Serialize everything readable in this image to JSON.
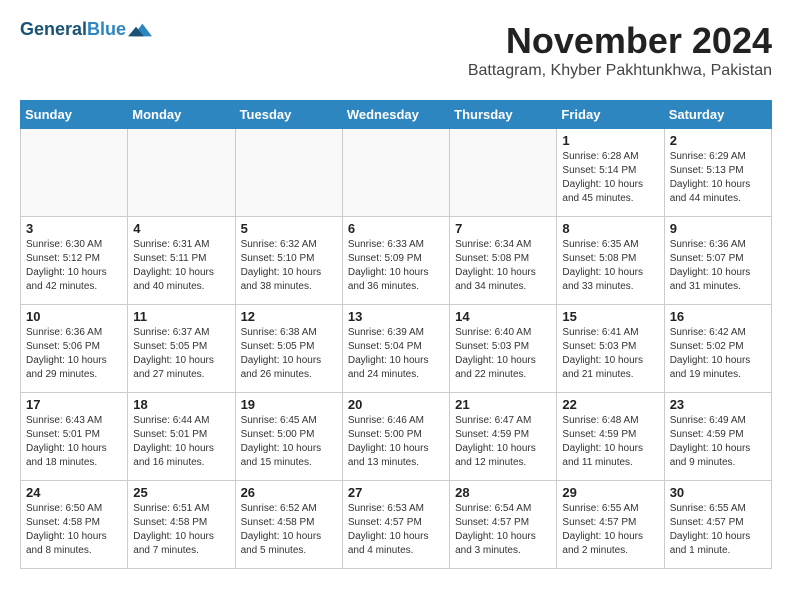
{
  "header": {
    "logo_line1": "General",
    "logo_line2": "Blue",
    "month_title": "November 2024",
    "location": "Battagram, Khyber Pakhtunkhwa, Pakistan"
  },
  "weekdays": [
    "Sunday",
    "Monday",
    "Tuesday",
    "Wednesday",
    "Thursday",
    "Friday",
    "Saturday"
  ],
  "weeks": [
    [
      {
        "day": "",
        "info": ""
      },
      {
        "day": "",
        "info": ""
      },
      {
        "day": "",
        "info": ""
      },
      {
        "day": "",
        "info": ""
      },
      {
        "day": "",
        "info": ""
      },
      {
        "day": "1",
        "info": "Sunrise: 6:28 AM\nSunset: 5:14 PM\nDaylight: 10 hours and 45 minutes."
      },
      {
        "day": "2",
        "info": "Sunrise: 6:29 AM\nSunset: 5:13 PM\nDaylight: 10 hours and 44 minutes."
      }
    ],
    [
      {
        "day": "3",
        "info": "Sunrise: 6:30 AM\nSunset: 5:12 PM\nDaylight: 10 hours and 42 minutes."
      },
      {
        "day": "4",
        "info": "Sunrise: 6:31 AM\nSunset: 5:11 PM\nDaylight: 10 hours and 40 minutes."
      },
      {
        "day": "5",
        "info": "Sunrise: 6:32 AM\nSunset: 5:10 PM\nDaylight: 10 hours and 38 minutes."
      },
      {
        "day": "6",
        "info": "Sunrise: 6:33 AM\nSunset: 5:09 PM\nDaylight: 10 hours and 36 minutes."
      },
      {
        "day": "7",
        "info": "Sunrise: 6:34 AM\nSunset: 5:08 PM\nDaylight: 10 hours and 34 minutes."
      },
      {
        "day": "8",
        "info": "Sunrise: 6:35 AM\nSunset: 5:08 PM\nDaylight: 10 hours and 33 minutes."
      },
      {
        "day": "9",
        "info": "Sunrise: 6:36 AM\nSunset: 5:07 PM\nDaylight: 10 hours and 31 minutes."
      }
    ],
    [
      {
        "day": "10",
        "info": "Sunrise: 6:36 AM\nSunset: 5:06 PM\nDaylight: 10 hours and 29 minutes."
      },
      {
        "day": "11",
        "info": "Sunrise: 6:37 AM\nSunset: 5:05 PM\nDaylight: 10 hours and 27 minutes."
      },
      {
        "day": "12",
        "info": "Sunrise: 6:38 AM\nSunset: 5:05 PM\nDaylight: 10 hours and 26 minutes."
      },
      {
        "day": "13",
        "info": "Sunrise: 6:39 AM\nSunset: 5:04 PM\nDaylight: 10 hours and 24 minutes."
      },
      {
        "day": "14",
        "info": "Sunrise: 6:40 AM\nSunset: 5:03 PM\nDaylight: 10 hours and 22 minutes."
      },
      {
        "day": "15",
        "info": "Sunrise: 6:41 AM\nSunset: 5:03 PM\nDaylight: 10 hours and 21 minutes."
      },
      {
        "day": "16",
        "info": "Sunrise: 6:42 AM\nSunset: 5:02 PM\nDaylight: 10 hours and 19 minutes."
      }
    ],
    [
      {
        "day": "17",
        "info": "Sunrise: 6:43 AM\nSunset: 5:01 PM\nDaylight: 10 hours and 18 minutes."
      },
      {
        "day": "18",
        "info": "Sunrise: 6:44 AM\nSunset: 5:01 PM\nDaylight: 10 hours and 16 minutes."
      },
      {
        "day": "19",
        "info": "Sunrise: 6:45 AM\nSunset: 5:00 PM\nDaylight: 10 hours and 15 minutes."
      },
      {
        "day": "20",
        "info": "Sunrise: 6:46 AM\nSunset: 5:00 PM\nDaylight: 10 hours and 13 minutes."
      },
      {
        "day": "21",
        "info": "Sunrise: 6:47 AM\nSunset: 4:59 PM\nDaylight: 10 hours and 12 minutes."
      },
      {
        "day": "22",
        "info": "Sunrise: 6:48 AM\nSunset: 4:59 PM\nDaylight: 10 hours and 11 minutes."
      },
      {
        "day": "23",
        "info": "Sunrise: 6:49 AM\nSunset: 4:59 PM\nDaylight: 10 hours and 9 minutes."
      }
    ],
    [
      {
        "day": "24",
        "info": "Sunrise: 6:50 AM\nSunset: 4:58 PM\nDaylight: 10 hours and 8 minutes."
      },
      {
        "day": "25",
        "info": "Sunrise: 6:51 AM\nSunset: 4:58 PM\nDaylight: 10 hours and 7 minutes."
      },
      {
        "day": "26",
        "info": "Sunrise: 6:52 AM\nSunset: 4:58 PM\nDaylight: 10 hours and 5 minutes."
      },
      {
        "day": "27",
        "info": "Sunrise: 6:53 AM\nSunset: 4:57 PM\nDaylight: 10 hours and 4 minutes."
      },
      {
        "day": "28",
        "info": "Sunrise: 6:54 AM\nSunset: 4:57 PM\nDaylight: 10 hours and 3 minutes."
      },
      {
        "day": "29",
        "info": "Sunrise: 6:55 AM\nSunset: 4:57 PM\nDaylight: 10 hours and 2 minutes."
      },
      {
        "day": "30",
        "info": "Sunrise: 6:55 AM\nSunset: 4:57 PM\nDaylight: 10 hours and 1 minute."
      }
    ]
  ]
}
